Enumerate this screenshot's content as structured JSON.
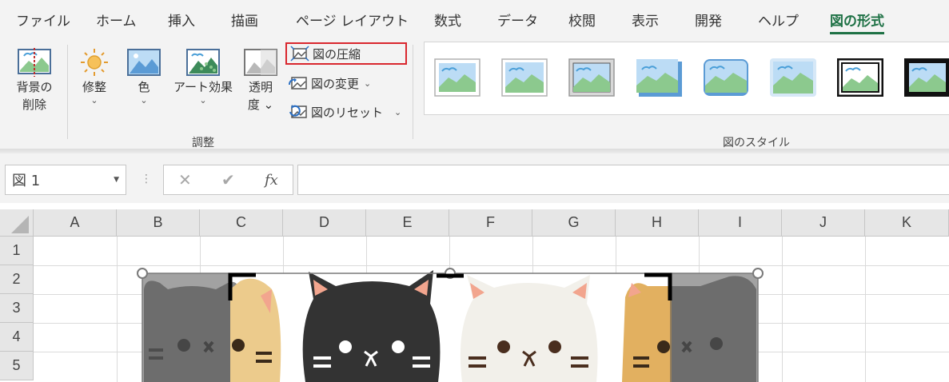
{
  "ribbon_tabs": [
    {
      "label": "ファイル",
      "active": false
    },
    {
      "label": "ホーム",
      "active": false
    },
    {
      "label": "挿入",
      "active": false
    },
    {
      "label": "描画",
      "active": false
    },
    {
      "label": "ページ レイアウト",
      "active": false
    },
    {
      "label": "数式",
      "active": false
    },
    {
      "label": "データ",
      "active": false
    },
    {
      "label": "校閲",
      "active": false
    },
    {
      "label": "表示",
      "active": false
    },
    {
      "label": "開発",
      "active": false
    },
    {
      "label": "ヘルプ",
      "active": false
    },
    {
      "label": "図の形式",
      "active": true
    }
  ],
  "ribbon": {
    "remove_background": {
      "line1": "背景の",
      "line2": "削除"
    },
    "corrections": "修整",
    "color": "色",
    "artistic_effects": "アート効果",
    "transparency": {
      "line1": "透明",
      "line2": "度"
    },
    "compress": "図の圧縮",
    "change_picture": "図の変更",
    "reset_picture": "図のリセット",
    "adjust_group": "調整",
    "styles_group": "図のスタイル"
  },
  "formula_bar": {
    "name_box": "図 1",
    "cancel_icon": "✕",
    "enter_icon": "✔",
    "fx_label": "fx",
    "formula_value": ""
  },
  "grid": {
    "columns": [
      "A",
      "B",
      "C",
      "D",
      "E",
      "F",
      "G",
      "H",
      "I",
      "J",
      "K"
    ],
    "rows": [
      "1",
      "2",
      "3",
      "4",
      "5"
    ]
  },
  "colors": {
    "accent": "#1e7145",
    "highlight_border": "#d9272e"
  }
}
